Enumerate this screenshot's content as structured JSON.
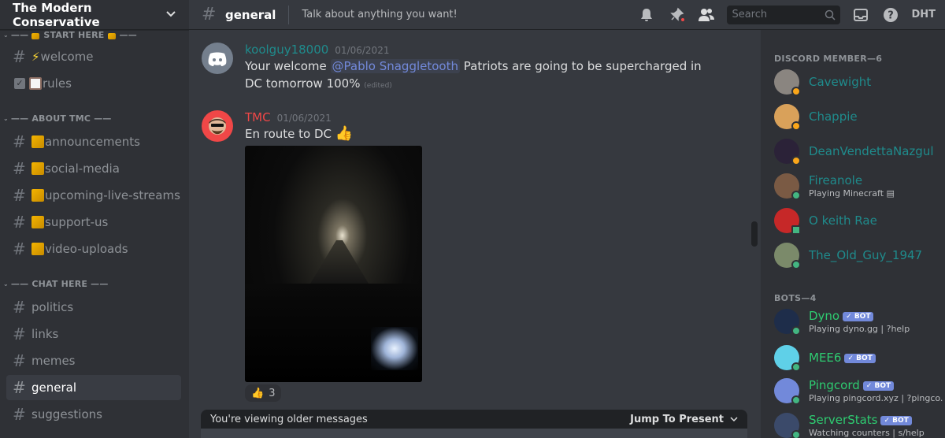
{
  "server": {
    "name": "The Modern Conservative"
  },
  "categories": [
    {
      "label": "START HERE"
    },
    {
      "label": "ABOUT TMC"
    },
    {
      "label": "CHAT HERE"
    }
  ],
  "channels": {
    "welcome": "welcome",
    "rules": "rules",
    "announcements": "announcements",
    "social_media": "social-media",
    "upcoming_live_streams": "upcoming-live-streams",
    "support_us": "support-us",
    "video_uploads": "video-uploads",
    "politics": "politics",
    "links": "links",
    "memes": "memes",
    "general": "general",
    "suggestions": "suggestions"
  },
  "topbar": {
    "channel": "general",
    "topic": "Talk about anything you want!",
    "search_placeholder": "Search",
    "user": "DHT"
  },
  "messages": [
    {
      "username": "koolguy18000",
      "color": "#1f8b8c",
      "timestamp": "01/06/2021",
      "pre": "Your welcome ",
      "mention": "@Pablo Snaggletooth",
      "post": "  Patriots are going to be supercharged in DC tomorrow 100%",
      "edited": "(edited)"
    },
    {
      "username": "TMC",
      "color": "#f04747",
      "timestamp": "01/06/2021",
      "text": "En route to DC",
      "reaction_count": "3"
    }
  ],
  "older_bar": {
    "text": "You're viewing older messages",
    "jump": "Jump To Present"
  },
  "member_groups": {
    "members_title": "DISCORD MEMBER—6",
    "bots_title": "BOTS—4"
  },
  "members": [
    {
      "name": "Cavewight",
      "status": "idle",
      "avatar_color": "#8a8580"
    },
    {
      "name": "Chappie",
      "status": "idle",
      "avatar_color": "#d9a15a"
    },
    {
      "name": "DeanVendettaNazgul",
      "status": "idle",
      "avatar_color": "#2b2238"
    },
    {
      "name": "Fireanole",
      "status": "online",
      "avatar_color": "#7a5a44",
      "activity": "Playing Minecraft"
    },
    {
      "name": "O keith Rae",
      "status": "online",
      "avatar_color": "#c62828"
    },
    {
      "name": "The_Old_Guy_1947",
      "status": "online",
      "avatar_color": "#7b8a6a"
    }
  ],
  "bots": [
    {
      "name": "Dyno",
      "tag": "BOT",
      "activity": "Playing dyno.gg | ?help",
      "avatar_color": "#1e2d4a"
    },
    {
      "name": "MEE6",
      "tag": "BOT",
      "activity": "",
      "avatar_color": "#5fd0e8"
    },
    {
      "name": "Pingcord",
      "tag": "BOT",
      "activity": "Playing pingcord.xyz | ?pingco...",
      "avatar_color": "#7289da"
    },
    {
      "name": "ServerStats",
      "tag": "BOT",
      "activity": "Watching counters | s/help",
      "avatar_color": "#3b4a6a"
    }
  ]
}
